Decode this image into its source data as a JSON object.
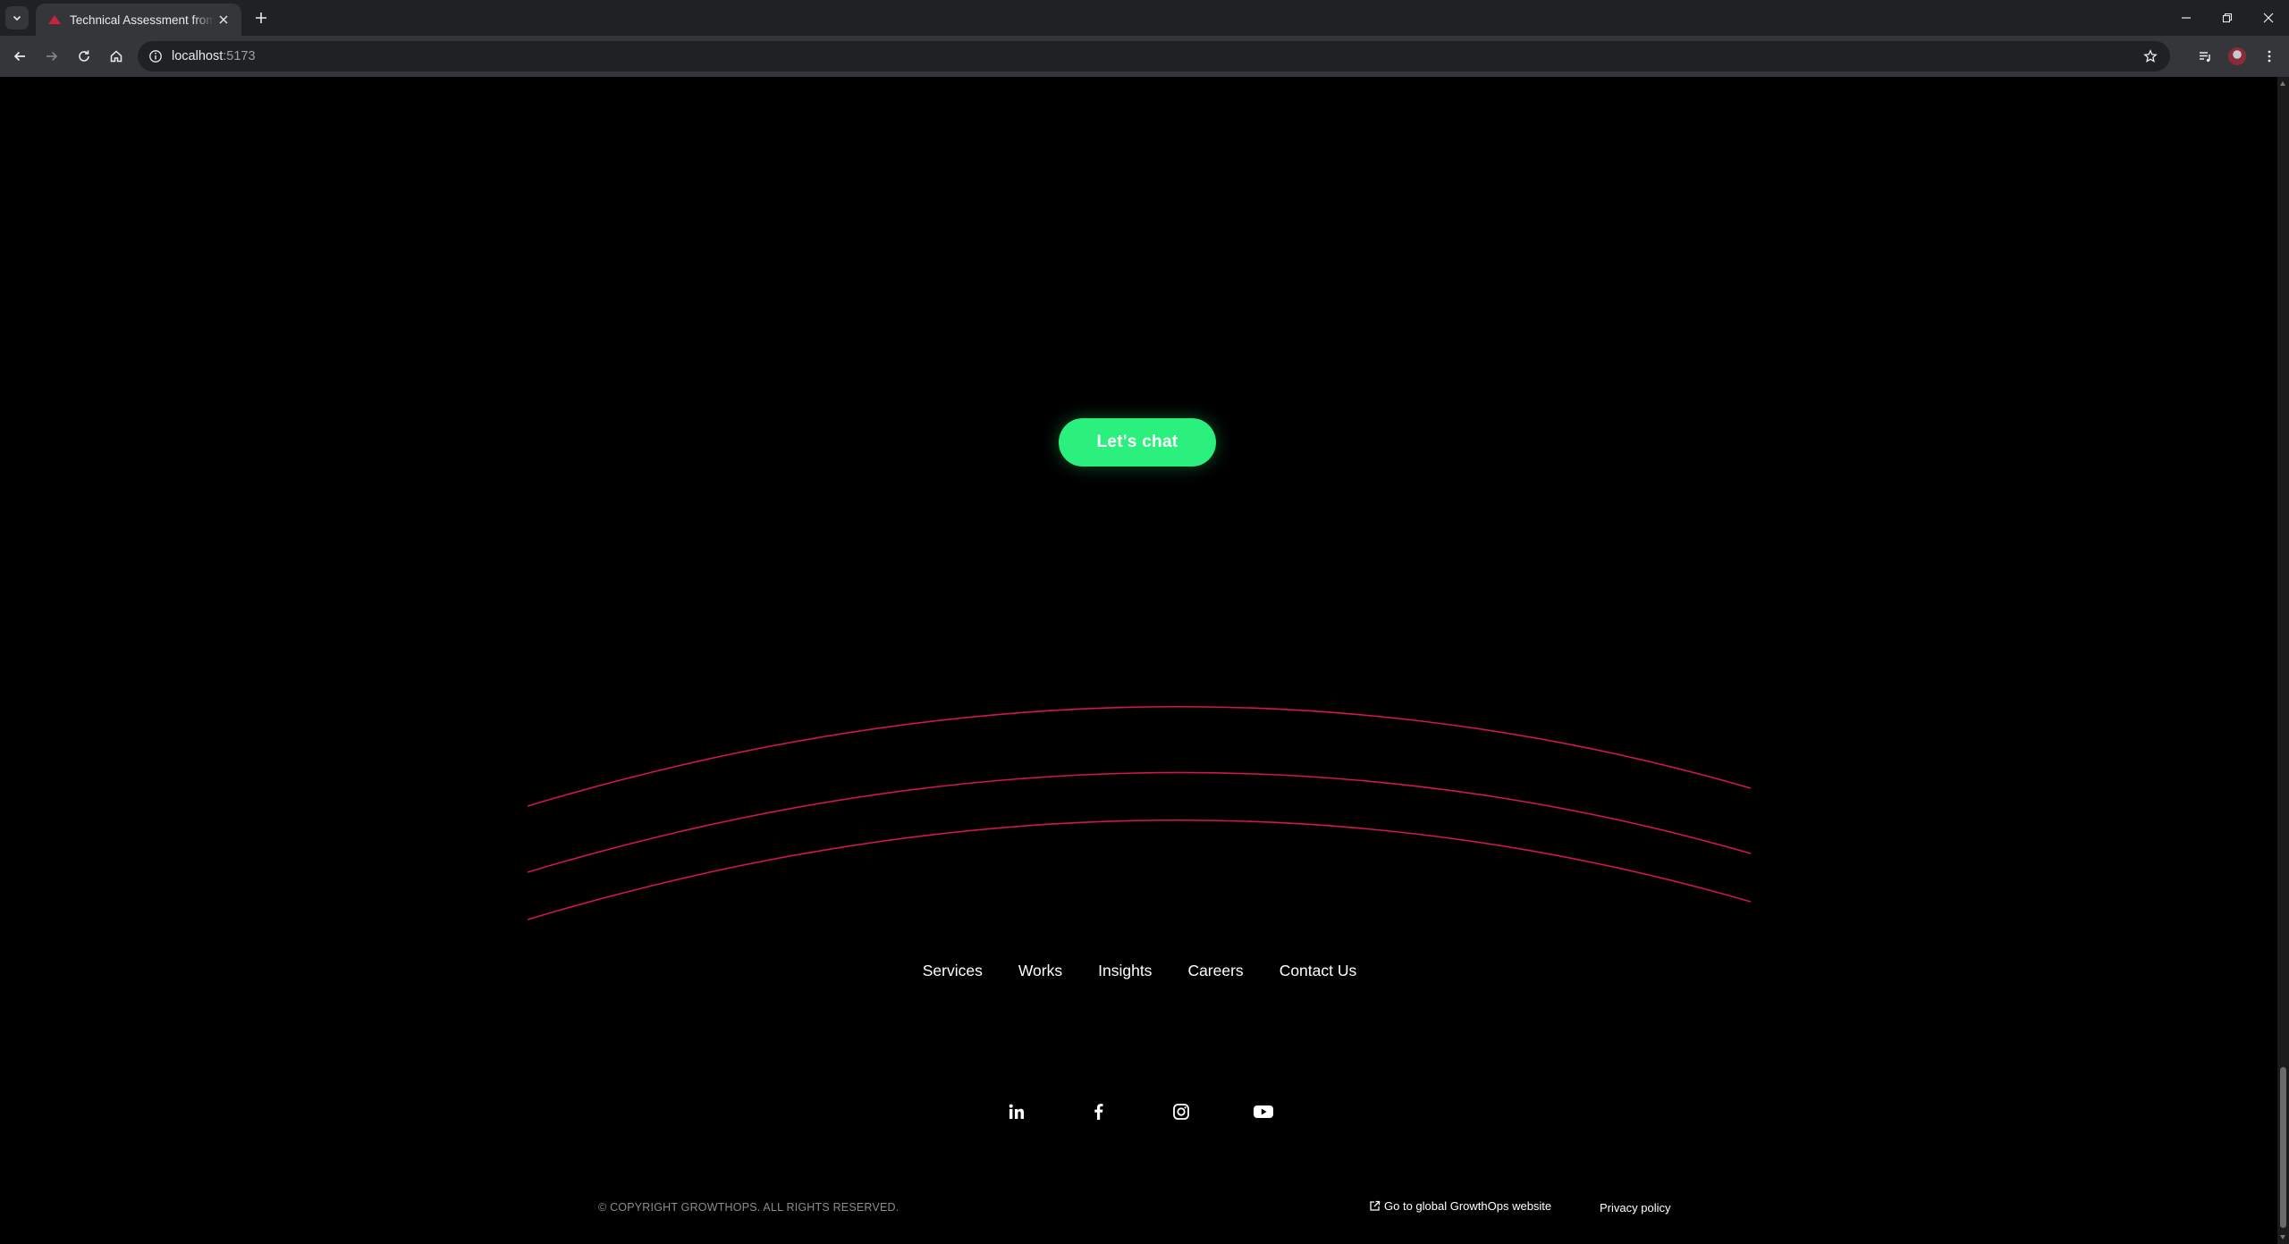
{
  "browser": {
    "tab_title": "Technical Assessment from GrowthOps",
    "url_host": "localhost",
    "url_port": ":5173"
  },
  "page": {
    "cta_label": "Let's chat",
    "accent_color": "#2bf07e",
    "arc_color": "#d0184a",
    "footer_nav": [
      {
        "label": "Services"
      },
      {
        "label": "Works"
      },
      {
        "label": "Insights"
      },
      {
        "label": "Careers"
      },
      {
        "label": "Contact Us"
      }
    ],
    "social_icons": [
      "linkedin-icon",
      "facebook-icon",
      "instagram-icon",
      "youtube-icon"
    ],
    "copyright": "© COPYRIGHT GROWTHOPS. ALL RIGHTS RESERVED.",
    "global_link": "Go to global GrowthOps website",
    "privacy_link": "Privacy policy"
  }
}
